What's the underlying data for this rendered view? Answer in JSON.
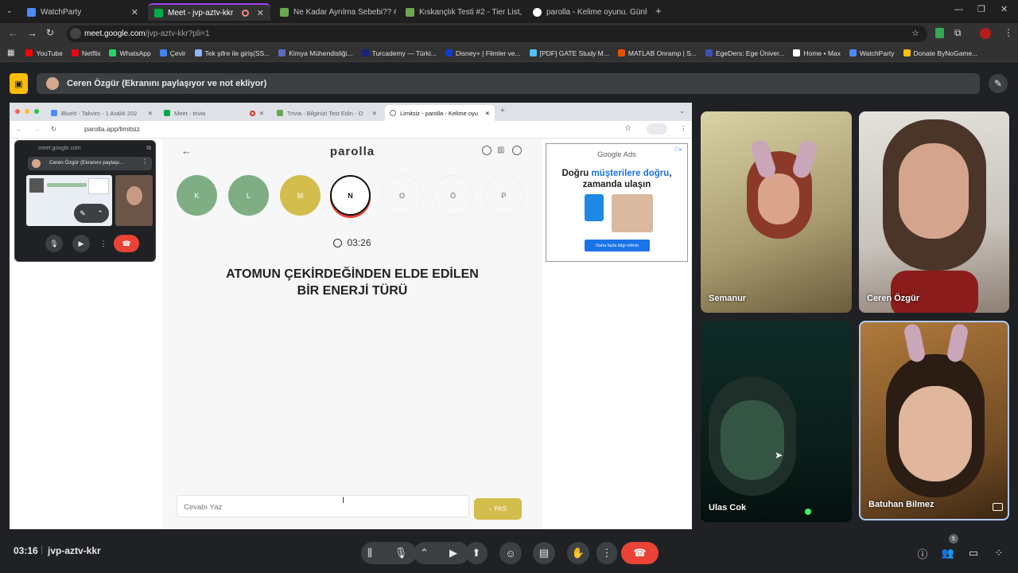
{
  "browser": {
    "tabs": [
      {
        "title": "WatchParty",
        "color": "#4c8bf5"
      },
      {
        "title": "Meet - jvp-aztv-kkr",
        "color": "#00ac47"
      },
      {
        "title": "Ne Kadar Ayrılma Sebebi?? #1",
        "color": "#6aa84f"
      },
      {
        "title": "Kıskançlık Testi #2 - Tier List, Kı",
        "color": "#6aa84f"
      },
      {
        "title": "parolla - Kelime oyunu. Günlük",
        "color": "#ffffff"
      }
    ],
    "url_host": "meet.google.com",
    "url_path": "/jvp-aztv-kkr?pli=1",
    "bookmarks": [
      {
        "label": "YouTube",
        "color": "#ff0000"
      },
      {
        "label": "Netflix",
        "color": "#e50914"
      },
      {
        "label": "WhatsApp",
        "color": "#25d366"
      },
      {
        "label": "Çevir",
        "color": "#4285f4"
      },
      {
        "label": "Tek şifre ile giriş(SS...",
        "color": "#8ab4f8"
      },
      {
        "label": "Kimya Mühendisliği...",
        "color": "#5c6bc0"
      },
      {
        "label": "Turcademy — Türki...",
        "color": "#1a237e"
      },
      {
        "label": "Disney+ | Filmler ve...",
        "color": "#113ccf"
      },
      {
        "label": "[PDF] GATE Study M...",
        "color": "#4fc3f7"
      },
      {
        "label": "MATLAB Onramp | S...",
        "color": "#e65100"
      },
      {
        "label": "EgeDers: Ege Üniver...",
        "color": "#3f51b5"
      },
      {
        "label": "Home • Max",
        "color": "#ffffff"
      },
      {
        "label": "WatchParty",
        "color": "#4c8bf5"
      },
      {
        "label": "Donate ByNoGame...",
        "color": "#ffc107"
      }
    ]
  },
  "meet": {
    "banner_text": "Ceren Özgür (Ekranını paylaşıyor ve not ekliyor)",
    "time": "03:16",
    "meeting_code": "jvp-aztv-kkr",
    "participant_count": "5",
    "participants": [
      {
        "name": "Semanur"
      },
      {
        "name": "Ceren Özgür"
      },
      {
        "name": "Ulas Cok"
      },
      {
        "name": "Batuhan Bilmez"
      }
    ]
  },
  "shared": {
    "tabs": [
      {
        "title": "BlueIt - Takvim - 1 Aralık 202"
      },
      {
        "title": "Meet - trivia"
      },
      {
        "title": "Trivia - Bilginizi Test Edin - O"
      },
      {
        "title": "Limitsiz - parolla - Kelime oyu"
      }
    ],
    "url": "parolla.app/limitsiz",
    "pip": {
      "url": "meet.google.com",
      "presenter": "Ceren Özgür (Ekranını paylaşı..."
    },
    "game": {
      "logo": "parolla",
      "letters": [
        "K",
        "L",
        "M",
        "N",
        "O",
        "Ö",
        "P"
      ],
      "letter_states": [
        "correct",
        "correct",
        "passed",
        "current",
        "pending",
        "pending",
        "pending"
      ],
      "timer": "03:26",
      "question_line1": "ATOMUN ÇEKİRDEĞİNDEN ELDE EDİLEN",
      "question_line2": "BİR ENERJİ TÜRÜ",
      "answer_placeholder": "Cevabı Yaz",
      "pass_label": "PAS"
    },
    "ad": {
      "brand": "Google Ads",
      "headline_part1": "Doğru ",
      "headline_highlight": "müşterilere doğru",
      "headline_part2": ", zamanda ulaşın",
      "cta": "Daha fazla bilgi edinin"
    }
  },
  "colors": {
    "correct": "#7fae84",
    "passed": "#d3bd4c",
    "accent_red": "#ea4335",
    "banner_icon": "#fbbc04"
  }
}
